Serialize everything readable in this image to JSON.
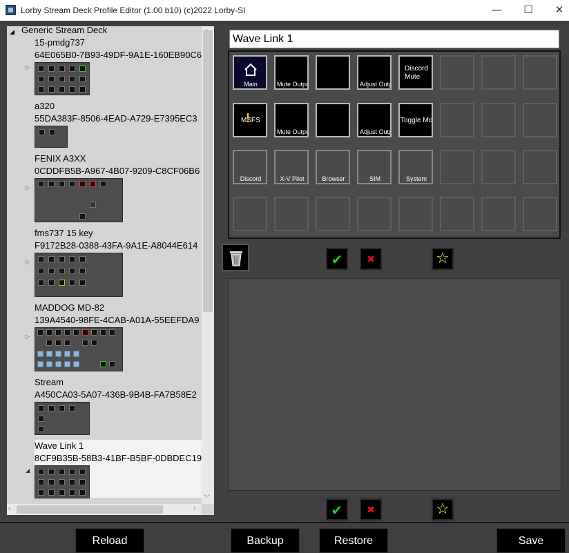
{
  "window": {
    "title": "Lorby Stream Deck Profile Editor (1.00 b10) (c)2022 Lorby-SI",
    "minimize": "—",
    "maximize": "☐",
    "close": "✕"
  },
  "tree": {
    "root_label": "Generic Stream Deck",
    "profiles": [
      {
        "name": "15-pmdg737",
        "guid": "64E065B0-7B93-49DF-9A1E-160EB90C6"
      },
      {
        "name": "a320",
        "guid": "55DA383F-8506-4EAD-A729-E7395EC3"
      },
      {
        "name": "FENIX A3XX",
        "guid": "0CDDFB5B-A967-4B07-9209-C8CF06B6"
      },
      {
        "name": "fms737 15 key",
        "guid": "F9172B28-0388-43FA-9A1E-A8044E614"
      },
      {
        "name": "MADDOG MD-82",
        "guid": "139A4540-98FE-4CAB-A01A-55EEFDA9"
      },
      {
        "name": "Stream",
        "guid": "A450CA03-5A07-436B-9B4B-FA7B58E2"
      },
      {
        "name": "Wave Link 1",
        "guid": "8CF9B35B-58B3-41BF-B5BF-0DBDEC19"
      }
    ]
  },
  "editor": {
    "profile_name": "Wave Link 1",
    "keys": {
      "k0": "Main",
      "k1": "Mute Output",
      "k3": "Adjust Output",
      "k4": "Discord Mute",
      "k8": "MSFS",
      "k9": "Mute Output",
      "k11": "Adjust Output",
      "k12": "Toggle Monitor",
      "k16": "Discord",
      "k17": "X-V Pilot",
      "k18": "Browser",
      "k19": "SIM",
      "k20": "System"
    }
  },
  "icons": {
    "trash": "trash-icon",
    "check": "✔",
    "cross": "✖",
    "star": "☆"
  },
  "colors": {
    "check_green": "#22cc33",
    "cross_red": "#e01010",
    "star_yellow": "#ffff33"
  },
  "buttons": {
    "reload": "Reload",
    "backup": "Backup",
    "restore": "Restore",
    "save": "Save"
  }
}
